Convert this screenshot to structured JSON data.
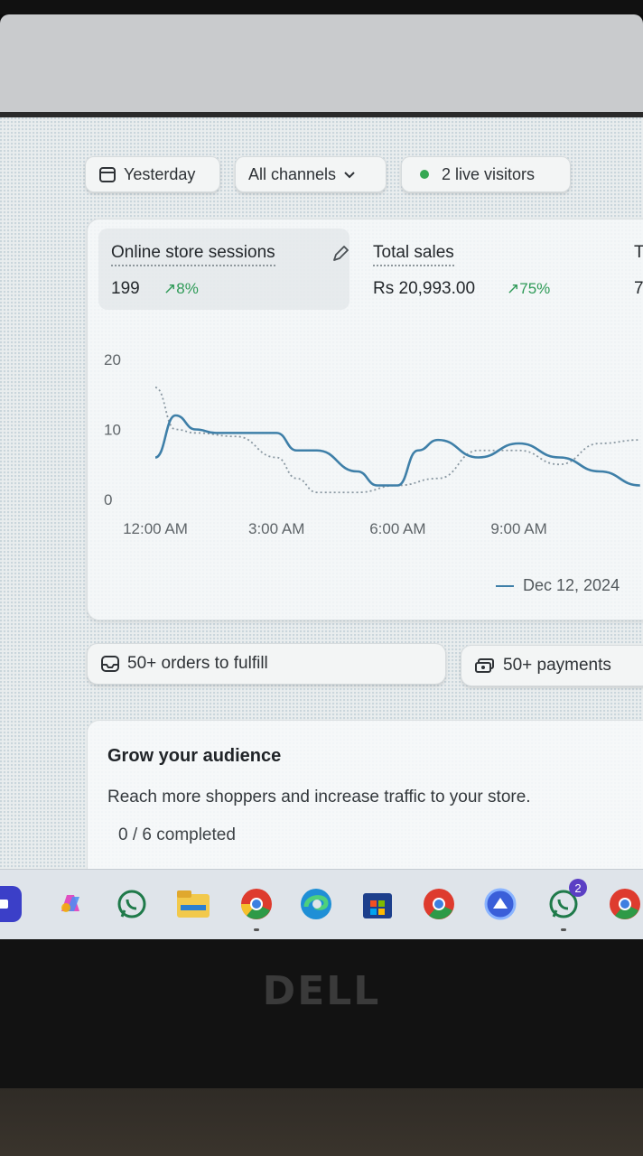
{
  "filters": {
    "date_label": "Yesterday",
    "channel_label": "All channels",
    "live_visitors": "2 live visitors"
  },
  "metrics": {
    "sessions_title": "Online store sessions",
    "sessions_value": "199",
    "sessions_change": "↗8%",
    "sales_title": "Total sales",
    "sales_value": "Rs 20,993.00",
    "sales_change": "↗75%",
    "cut_title": "T",
    "cut_value": "7"
  },
  "chart_data": {
    "type": "line",
    "y_ticks": [
      "20",
      "10",
      "0"
    ],
    "x_ticks": [
      "12:00 AM",
      "3:00 AM",
      "6:00 AM",
      "9:00 AM"
    ],
    "ylim": [
      0,
      20
    ],
    "series": [
      {
        "name": "Dec 12, 2024",
        "style": "solid",
        "color": "#3e7fa8",
        "x_hours": [
          0,
          0.5,
          1,
          1.5,
          2,
          3,
          3.5,
          4,
          5,
          5.5,
          6,
          6.5,
          7,
          8,
          9,
          10,
          11,
          12
        ],
        "y": [
          6,
          12,
          10,
          9.5,
          9.5,
          9.5,
          7,
          7,
          4,
          2,
          2,
          7,
          8.5,
          6,
          8,
          6,
          4,
          2
        ]
      },
      {
        "name": "",
        "style": "dotted",
        "color": "#8a98a2",
        "x_hours": [
          0,
          0.5,
          1,
          2,
          3,
          3.5,
          4,
          5,
          6,
          7,
          8,
          9,
          10,
          11,
          12
        ],
        "y": [
          16,
          10,
          9.5,
          9,
          6,
          3,
          1,
          1,
          2,
          3,
          7,
          7,
          5,
          8,
          8.5
        ]
      }
    ],
    "legend": "Dec 12, 2024",
    "legend_position": "bottom-right",
    "grid": false
  },
  "actions": {
    "orders_label": "50+ orders to fulfill",
    "payments_label": "50+ payments"
  },
  "grow": {
    "title": "Grow your audience",
    "description": "Reach more shoppers and increase traffic to your store.",
    "progress": "0 / 6 completed"
  },
  "taskbar": {
    "whatsapp_badge": "2"
  },
  "laptop": {
    "brand": "DELL"
  }
}
